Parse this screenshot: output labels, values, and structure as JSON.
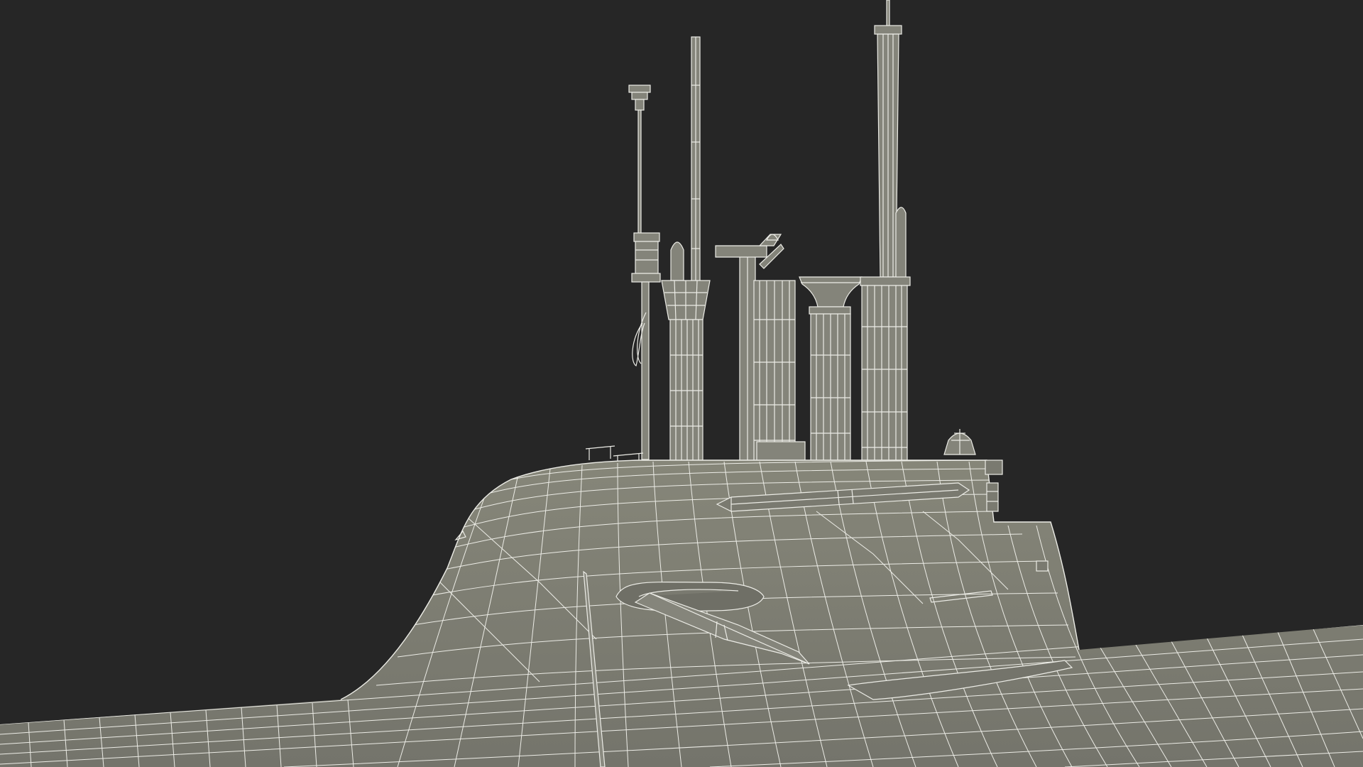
{
  "scene": {
    "subject": "submarine-sail-wireframe",
    "colors": {
      "background": "#262626",
      "hull_fill": "#7d7d73",
      "hull_shadow": "#6b6b62",
      "hull_highlight": "#8a8a80",
      "mast_fill": "#84847a",
      "wire": "#ecece6"
    }
  }
}
